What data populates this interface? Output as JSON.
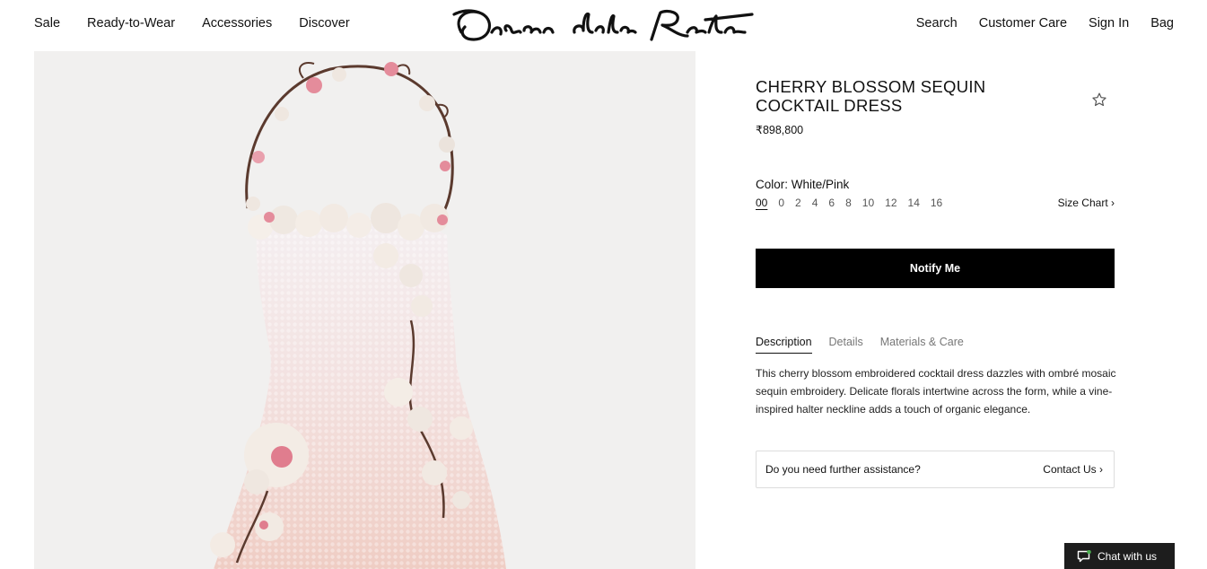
{
  "brand": "Oscar de la Renta",
  "nav": {
    "left": [
      "Sale",
      "Ready-to-Wear",
      "Accessories",
      "Discover"
    ],
    "right": [
      "Search",
      "Customer Care",
      "Sign In",
      "Bag"
    ]
  },
  "product": {
    "title": "CHERRY BLOSSOM SEQUIN COCKTAIL DRESS",
    "price": "₹898,800",
    "color_label": "Color: White/Pink",
    "sizes": [
      "00",
      "0",
      "2",
      "4",
      "6",
      "8",
      "10",
      "12",
      "14",
      "16"
    ],
    "selected_size": "00",
    "size_chart": "Size Chart",
    "cta": "Notify Me",
    "tabs": [
      "Description",
      "Details",
      "Materials & Care"
    ],
    "active_tab": "Description",
    "description": "This cherry blossom embroidered cocktail dress dazzles with ombré mosaic sequin embroidery. Delicate florals intertwine across the form, while a vine-inspired halter neckline adds a touch of organic elegance."
  },
  "assistance": {
    "question": "Do you need further assistance?",
    "link": "Contact Us"
  },
  "chat": {
    "label": "Chat with us",
    "status_color": "#4caf50"
  },
  "colors": {
    "button_bg": "#000000",
    "image_bg": "#f1f0ef",
    "dress_top": "#f3eef0",
    "dress_bottom": "#f1d3cc",
    "blossom_pink": "#e58a9a"
  },
  "icons": [
    "star-outline-icon",
    "chevron-right-icon",
    "chat-bubble-icon"
  ]
}
